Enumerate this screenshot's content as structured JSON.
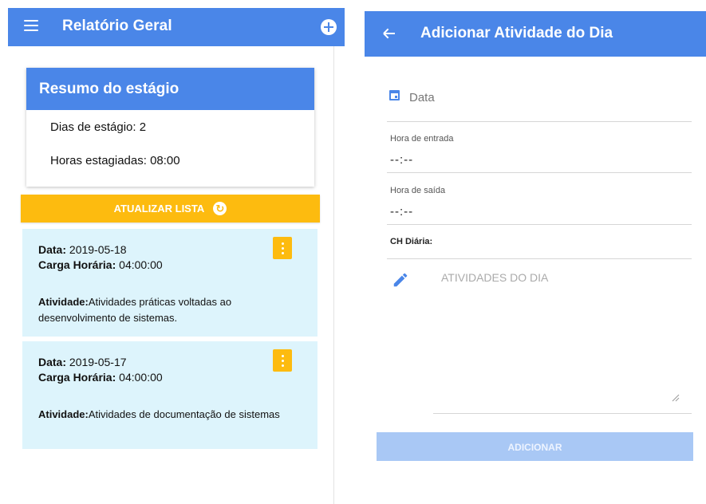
{
  "left": {
    "header": {
      "title": "Relatório Geral",
      "menu_icon": "menu-icon",
      "add_icon": "add-circle-icon"
    },
    "summary": {
      "title": "Resumo do estágio",
      "days_line": "Dias de estágio: 2",
      "hours_line": "Horas estagiadas: 08:00"
    },
    "refresh_button": {
      "label": "ATUALIZAR LISTA",
      "icon": "refresh-icon",
      "icon_glyph": "↻"
    },
    "activities": [
      {
        "date_label": "Data:",
        "date_value": " 2019-05-18",
        "hours_label": "Carga Horária:",
        "hours_value": " 04:00:00",
        "activity_label": "Atividade:",
        "activity_value": "Atividades práticas voltadas ao desenvolvimento de sistemas."
      },
      {
        "date_label": "Data:",
        "date_value": " 2019-05-17",
        "hours_label": "Carga Horária:",
        "hours_value": " 04:00:00",
        "activity_label": "Atividade:",
        "activity_value": "Atividades de documentação de sistemas"
      }
    ]
  },
  "right": {
    "header": {
      "title": "Adicionar Atividade do Dia",
      "back_icon": "arrow-back-icon"
    },
    "form": {
      "date_placeholder": "Data",
      "entry_label": "Hora de entrada",
      "entry_value": "--:--",
      "exit_label": "Hora de saída",
      "exit_value": "--:--",
      "daily_hours_label": "CH Diária:",
      "activities_placeholder": "ATIVIDADES DO DIA",
      "submit_label": "ADICIONAR"
    }
  },
  "colors": {
    "primary": "#4a86e8",
    "accent": "#fdbb0f",
    "card_bg": "#ddf4fc",
    "disabled_button": "#a9c8f5"
  }
}
